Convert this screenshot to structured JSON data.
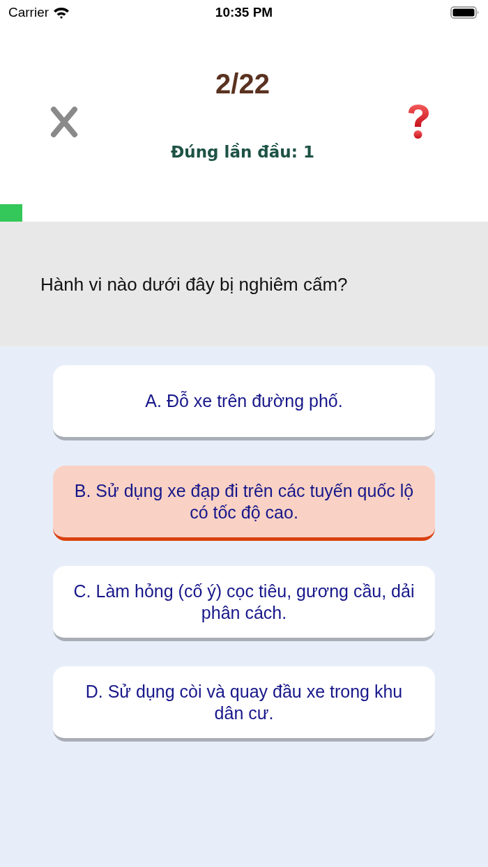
{
  "status_bar": {
    "carrier": "Carrier",
    "time": "10:35 PM"
  },
  "header": {
    "counter": "2/22",
    "first_try_correct": "Đúng lần đầu: 1"
  },
  "progress": {
    "level": 0.046
  },
  "question": {
    "text": "Hành vi nào dưới đây bị nghiêm cấm?"
  },
  "answers": [
    {
      "label": "A. Đỗ xe trên đường phố.",
      "selected": false
    },
    {
      "label": "B. Sử dụng xe đạp đi trên các tuyến quốc lộ có tốc độ cao.",
      "selected": true
    },
    {
      "label": "C. Làm hỏng (cố ý) cọc tiêu, gương cầu, dải phân cách.",
      "selected": false
    },
    {
      "label": "D. Sử dụng còi và quay đầu xe trong khu dân cư.",
      "selected": false
    }
  ]
}
